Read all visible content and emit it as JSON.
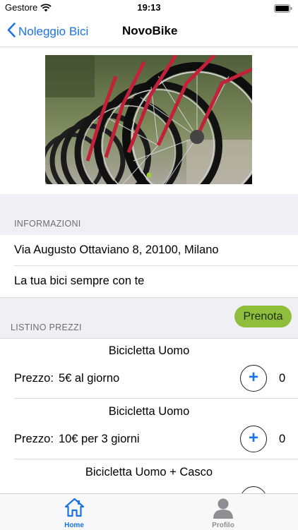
{
  "status_bar": {
    "carrier": "Gestore",
    "time": "19:13"
  },
  "nav": {
    "back_label": "Noleggio Bici",
    "title": "NovoBike"
  },
  "hero": {
    "image": "bicycle-wheels-photo"
  },
  "info": {
    "header": "INFORMAZIONI",
    "address": "Via Augusto Ottaviano 8, 20100, Milano",
    "tagline": "La tua bici sempre con te"
  },
  "prices": {
    "header": "LISTINO PREZZI",
    "book_label": "Prenota",
    "price_label": "Prezzo:",
    "items": [
      {
        "title": "Bicicletta Uomo",
        "price": "5€ al giorno",
        "quantity": "0"
      },
      {
        "title": "Bicicletta Uomo",
        "price": "10€ per 3 giorni",
        "quantity": "0"
      },
      {
        "title": "Bicicletta Uomo + Casco"
      }
    ]
  },
  "tabs": [
    {
      "label": "Home",
      "icon": "home-icon",
      "active": true
    },
    {
      "label": "Profilo",
      "icon": "person-icon",
      "active": false
    }
  ],
  "colors": {
    "accent": "#1a73e8",
    "book_button": "#8fbd3c",
    "section_bg": "#efeff4",
    "inactive_tab": "#8e8e93"
  }
}
